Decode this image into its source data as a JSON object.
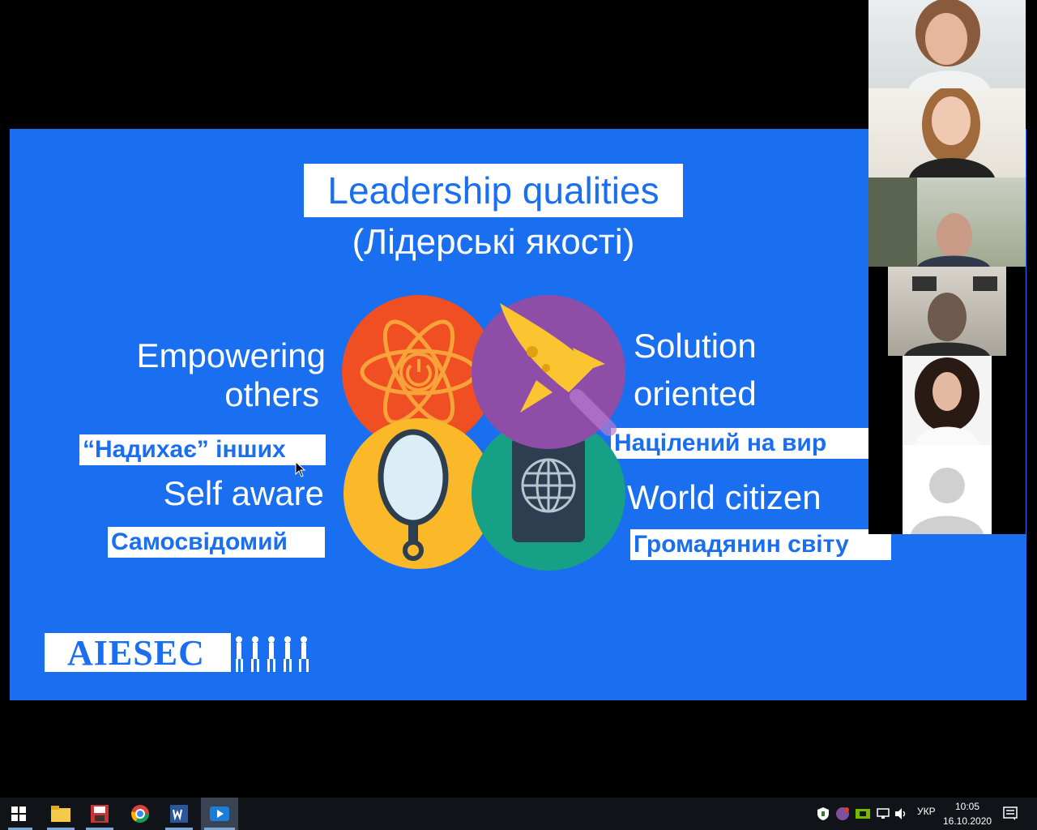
{
  "slide": {
    "title_en": "Leadership qualities",
    "title_ua": "(Лідерські якості)",
    "qualities": {
      "empowering_en_line1": "Empowering",
      "empowering_en_line2": "others",
      "empowering_ua": "“Надихає” інших",
      "self_aware_en": "Self aware",
      "self_aware_ua": "Самосвідомий",
      "solution_en_line1": "Solution",
      "solution_en_line2": "oriented",
      "solution_ua": "Націлений на вир",
      "world_citizen_en": "World citizen",
      "world_citizen_ua": "Громадянин світу"
    },
    "logo_text": "AIESEC",
    "colors": {
      "background": "#1a6ef0",
      "atom_circle": "#f04e23",
      "rocket_circle": "#8e4ea8",
      "mirror_circle": "#fbb829",
      "globe_circle": "#16a085"
    }
  },
  "participants": [
    {
      "icon": "participant-video-1"
    },
    {
      "icon": "participant-video-2"
    },
    {
      "icon": "participant-video-3"
    },
    {
      "icon": "participant-video-4"
    },
    {
      "icon": "participant-video-5"
    },
    {
      "icon": "participant-avatar-placeholder"
    }
  ],
  "taskbar": {
    "apps": [
      "start-icon",
      "file-explorer-icon",
      "save-app-icon",
      "chrome-icon",
      "word-icon",
      "media-player-icon"
    ],
    "language": "УКР",
    "time": "10:05",
    "date": "16.10.2020"
  }
}
